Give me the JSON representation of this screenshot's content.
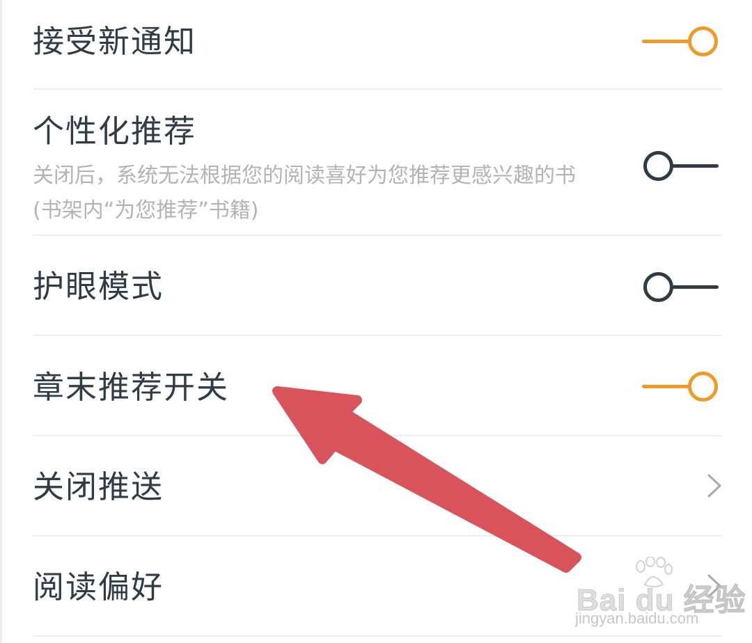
{
  "settings": {
    "notifications": {
      "label": "接受新通知",
      "enabled": true
    },
    "personalized": {
      "label": "个性化推荐",
      "description": "关闭后，系统无法根据您的阅读喜好为您推荐更感兴趣的书(书架内“为您推荐”书籍)",
      "enabled": false
    },
    "eye_care": {
      "label": "护眼模式",
      "enabled": false
    },
    "chapter_end": {
      "label": "章末推荐开关",
      "enabled": true
    },
    "close_push": {
      "label": "关闭推送",
      "icon": "chevron-right-icon"
    },
    "reading_pref": {
      "label": "阅读偏好",
      "icon": "chevron-right-icon"
    }
  },
  "colors": {
    "toggle_on": "#f19927",
    "toggle_off": "#2f3b47",
    "annotation_arrow": "#d9545a"
  },
  "watermark": {
    "brand": "Bai du 经验",
    "url": "jingyan.baidu.com"
  }
}
